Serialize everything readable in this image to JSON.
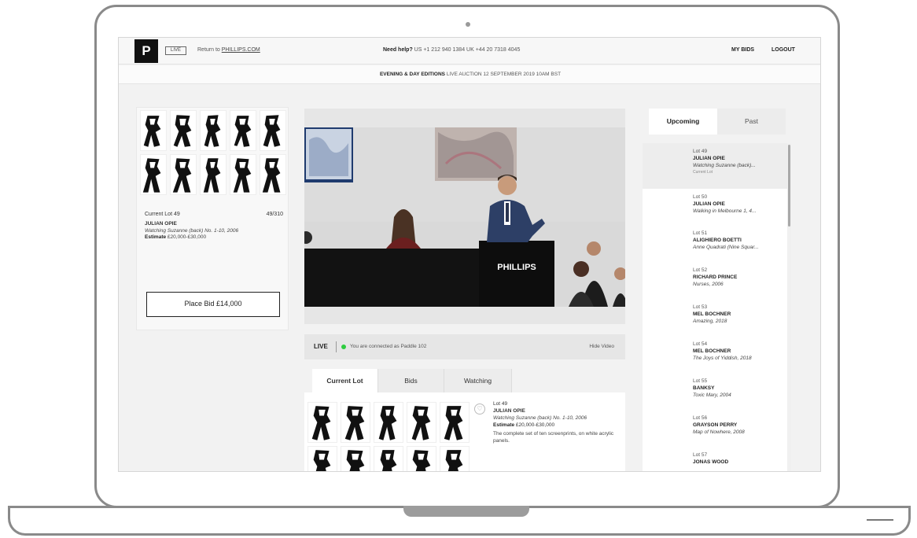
{
  "header": {
    "logo": "P",
    "badge": "LIVE",
    "return_prefix": "Return to ",
    "return_link": "PHILLIPS.COM",
    "help_label": "Need help?",
    "help_numbers": " US +1 212 940 1384  UK +44 20 7318 4045",
    "my_bids": "MY BIDS",
    "logout": "LOGOUT"
  },
  "auction": {
    "title": "EVENING & DAY EDITIONS",
    "schedule": "   LIVE AUCTION 12 SEPTEMBER 2019 10AM BST"
  },
  "current_lot": {
    "label": "Current Lot 49",
    "count": "49/310",
    "artist": "JULIAN OPIE",
    "title": "Watching Suzanne (back) No. 1-10, 2006",
    "estimate_label": "Estimate",
    "estimate": " £20,000-£30,000",
    "place_bid": "Place Bid £14,000"
  },
  "video": {
    "podium_text": "PHILLIPS",
    "live_label": "LIVE",
    "status": "You are connected as Paddle 102",
    "hide_video": "Hide Video",
    "accent_live": "#2ecc40"
  },
  "tabs": [
    {
      "label": "Current Lot",
      "active": true
    },
    {
      "label": "Bids",
      "active": false
    },
    {
      "label": "Watching",
      "active": false
    }
  ],
  "tab_detail": {
    "lot": "Lot 49",
    "artist": "JULIAN OPIE",
    "title": "Watching Suzanne (back) No. 1-10, 2006",
    "estimate_label": "Estimate",
    "estimate": " £20,000-£30,000",
    "description": "The complete set of ten screenprints, on white acrylic panels."
  },
  "right_panel": {
    "tabs": [
      "Upcoming",
      "Past"
    ],
    "lots": [
      {
        "num": "Lot 49",
        "artist": "JULIAN OPIE",
        "title": "Watching Suzanne (back)...",
        "note": "Current Lot"
      },
      {
        "num": "Lot 50",
        "artist": "JULIAN OPIE",
        "title": "Walking in Melbourne 1, 4..."
      },
      {
        "num": "Lot 51",
        "artist": "ALIGHIERO BOETTI",
        "title": "Anne Quadrati (Nine Squar..."
      },
      {
        "num": "Lot 52",
        "artist": "RICHARD PRINCE",
        "title": "Nurses, 2006"
      },
      {
        "num": "Lot 53",
        "artist": "MEL BOCHNER",
        "title": "Amazing, 2018"
      },
      {
        "num": "Lot 54",
        "artist": "MEL BOCHNER",
        "title": "The Joys of Yiddish, 2018"
      },
      {
        "num": "Lot 55",
        "artist": "BANKSY",
        "title": "Toxic Mary, 2004"
      },
      {
        "num": "Lot 56",
        "artist": "GRAYSON PERRY",
        "title": "Map of Nowhere, 2008"
      },
      {
        "num": "Lot 57",
        "artist": "JONAS WOOD",
        "title": ""
      }
    ]
  }
}
